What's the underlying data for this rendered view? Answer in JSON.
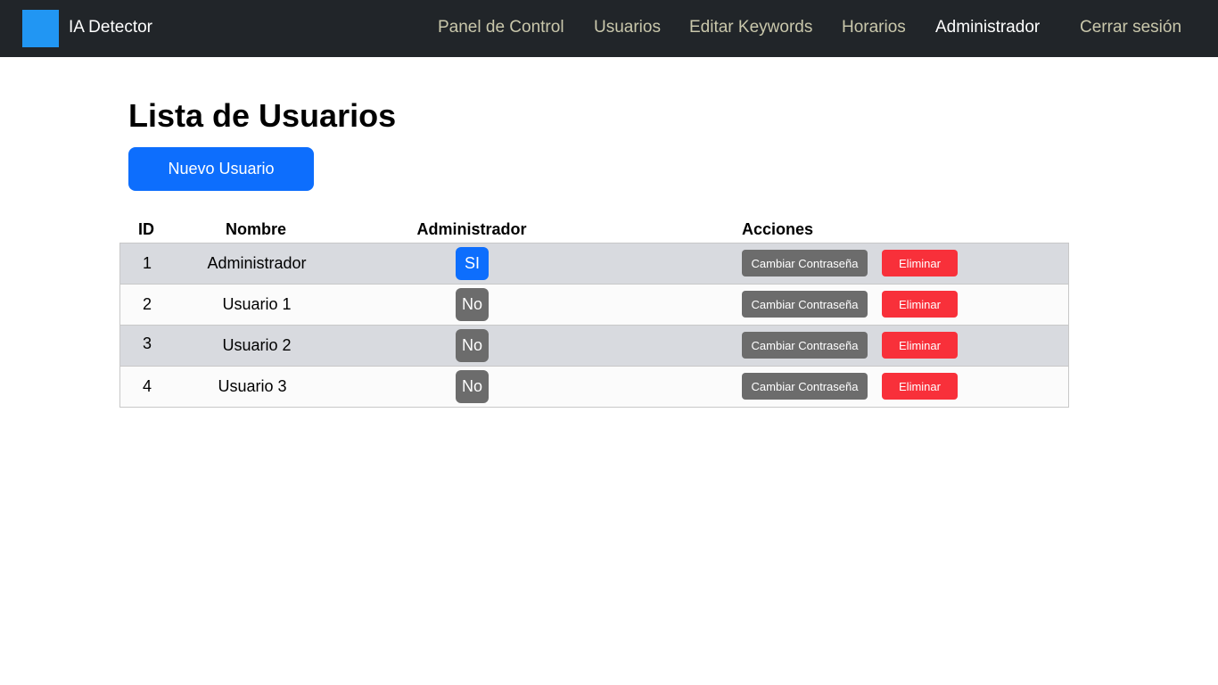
{
  "navbar": {
    "brand": "IA Detector",
    "links": [
      {
        "label": "Panel de Control"
      },
      {
        "label": "Usuarios"
      },
      {
        "label": "Editar Keywords"
      },
      {
        "label": "Horarios"
      },
      {
        "label": "Administrador"
      },
      {
        "label": "Cerrar sesión"
      }
    ],
    "active_link": "Administrador",
    "brand_logo_color": "#2196f3",
    "background_color": "#212529"
  },
  "main": {
    "title": "Lista de Usuarios",
    "new_user_button": "Nuevo Usuario",
    "table": {
      "headers": [
        "ID",
        "Nombre",
        "Administrador",
        "Acciones"
      ],
      "rows": [
        {
          "id": "1",
          "name": "Administrador",
          "admin": "SI",
          "change_password": "Cambiar Contraseña",
          "delete": "Eliminar"
        },
        {
          "id": "2",
          "name": "Usuario 1",
          "admin": "No",
          "change_password": "Cambiar Contraseña",
          "delete": "Eliminar"
        },
        {
          "id": "3",
          "name": "Usuario 2",
          "admin": "No",
          "change_password": "Cambiar Contraseña",
          "delete": "Eliminar"
        },
        {
          "id": "4",
          "name": "Usuario 3",
          "admin": "No",
          "change_password": "Cambiar Contraseña",
          "delete": "Eliminar"
        }
      ]
    }
  },
  "colors": {
    "primary": "#0d6efd",
    "secondary": "#6c6c6c",
    "danger": "#f8303a",
    "row_striped": "#d8dadf"
  }
}
